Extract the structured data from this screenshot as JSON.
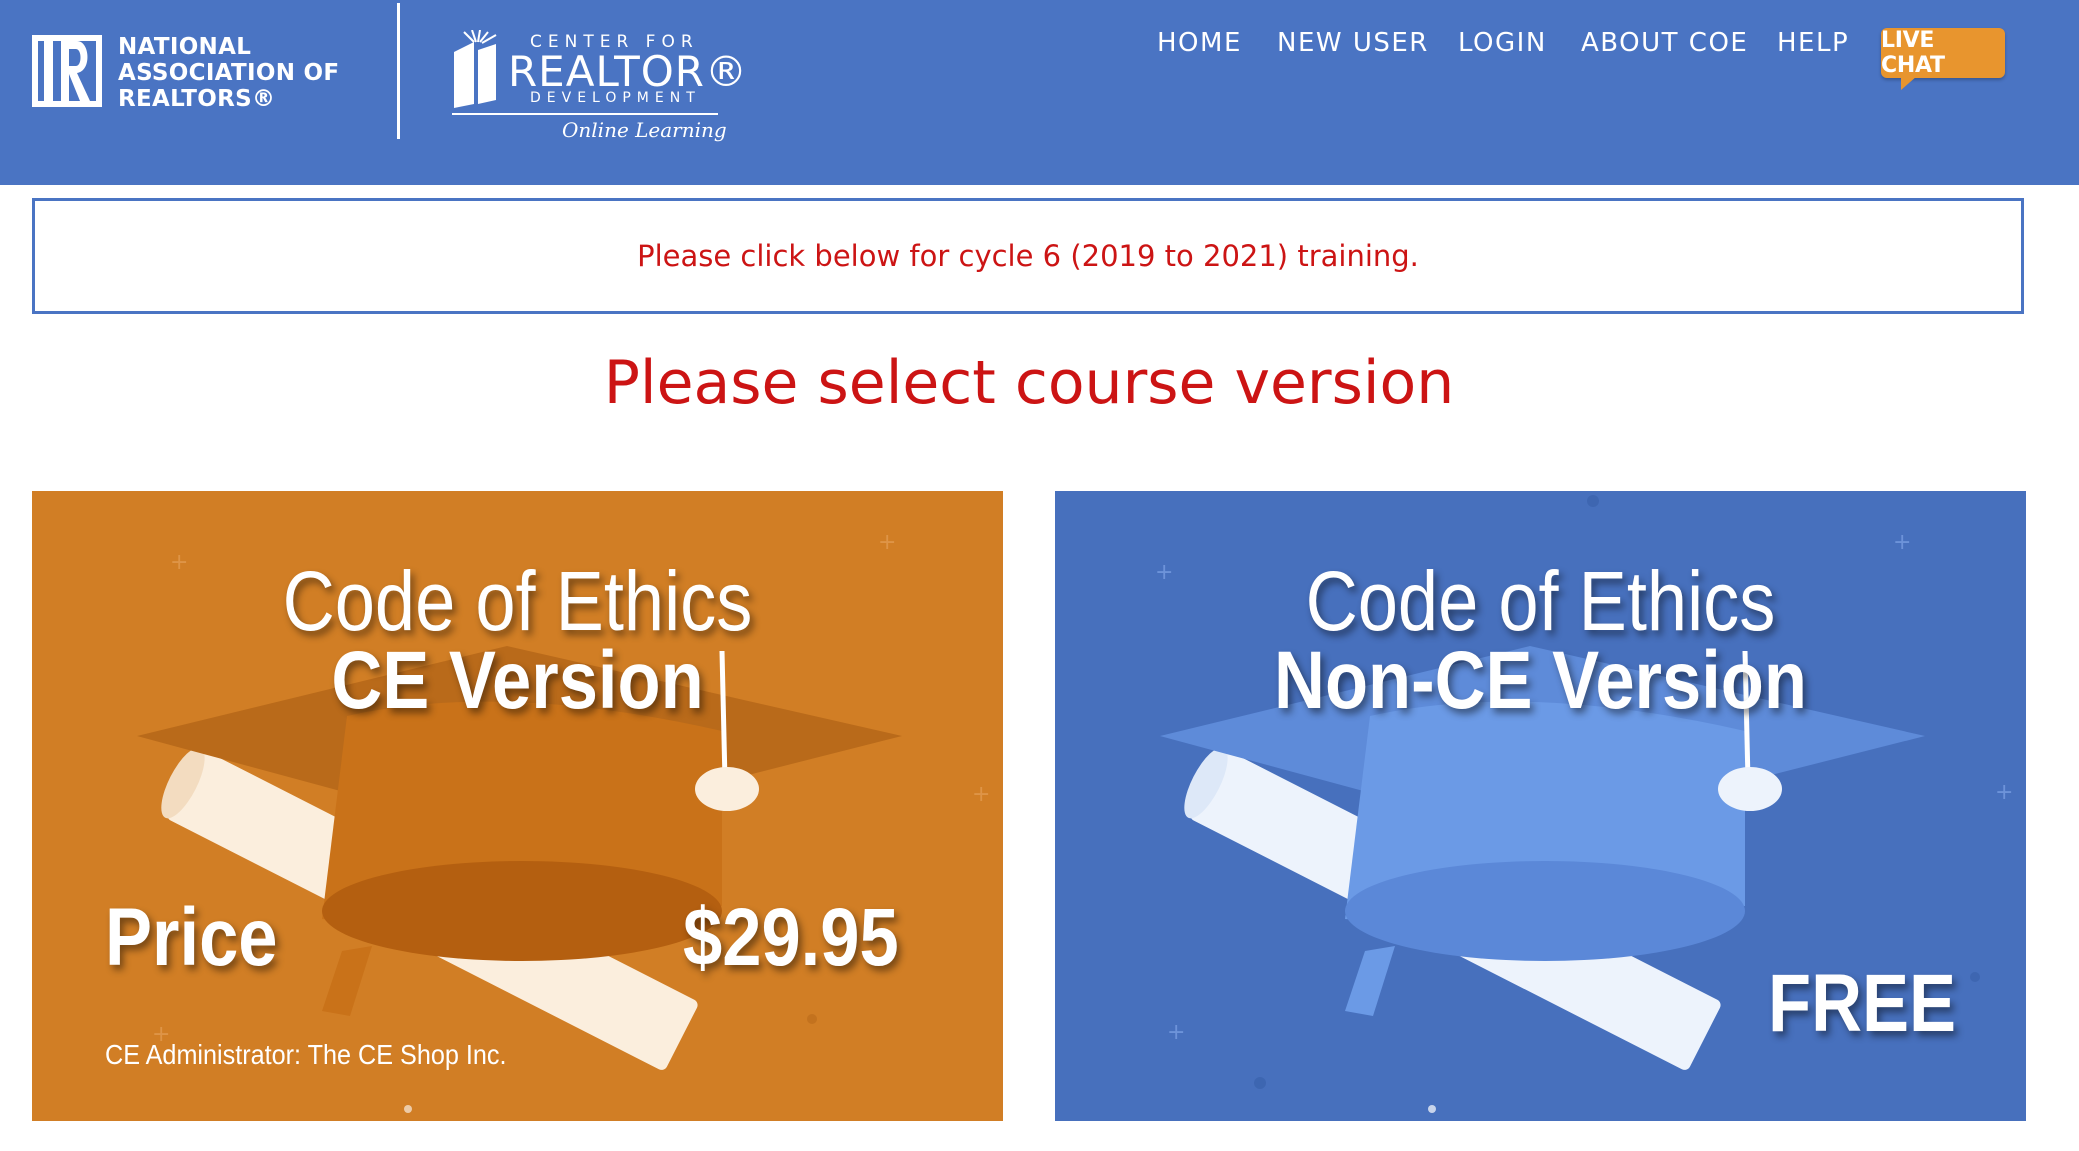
{
  "header": {
    "nar_logo_text": [
      "NATIONAL",
      "ASSOCIATION OF",
      "REALTORS®"
    ],
    "crd_logo": {
      "top": "CENTER FOR",
      "main": "REALTOR®",
      "sub": "DEVELOPMENT",
      "tagline": "Online Learning"
    },
    "nav": [
      {
        "label": "HOME"
      },
      {
        "label": "NEW USER"
      },
      {
        "label": "LOGIN"
      },
      {
        "label": "ABOUT COE"
      },
      {
        "label": "HELP"
      }
    ],
    "live_chat_label": "LIVE CHAT"
  },
  "notice": {
    "text": "Please click below for cycle 6 (2019 to 2021) training."
  },
  "page_title": "Please select course version",
  "cards": [
    {
      "line1": "Code of Ethics",
      "line2": "CE Version",
      "price_label": "Price",
      "price_value": "$29.95",
      "admin": "CE Administrator: The CE Shop Inc.",
      "color": "#d17e25"
    },
    {
      "line1": "Code of Ethics",
      "line2": "Non-CE Version",
      "price_value": "FREE",
      "color": "#4770bd"
    }
  ],
  "colors": {
    "header_bg": "#4a74c3",
    "accent_red": "#cc1414",
    "live_chat": "#e8952e"
  }
}
